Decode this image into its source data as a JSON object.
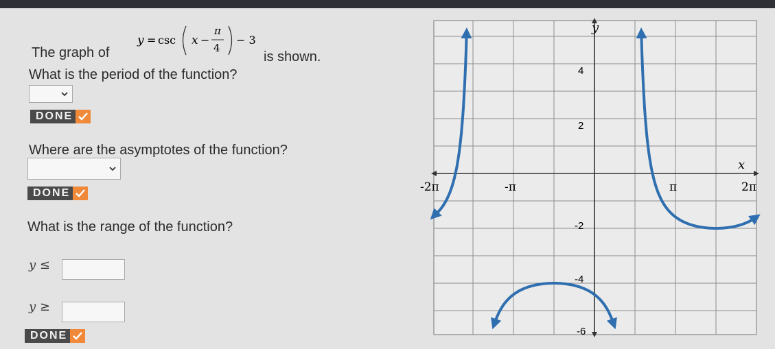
{
  "question": {
    "intro": "The graph of",
    "formula": {
      "lhs": "y",
      "eq": "=",
      "func": "csc",
      "var": "x",
      "minus": "−",
      "pi": "π",
      "den": "4",
      "shift": "− 3"
    },
    "shown": "is shown."
  },
  "period": {
    "question": "What is the period of the function?",
    "selected": ""
  },
  "asymptotes": {
    "question": "Where are the asymptotes of the function?",
    "selected": ""
  },
  "range": {
    "question": "What is the range of the function?",
    "le_label": "y ≤",
    "ge_label": "y ≥",
    "le_value": "",
    "ge_value": ""
  },
  "done_label": "DONE",
  "colors": {
    "curve": "#2f6fb0",
    "done_bg": "#4a4a4a",
    "check": "#f08a3a"
  },
  "graph": {
    "x_axis_label": "x",
    "y_axis_label": "y",
    "x_ticks": [
      "-2π",
      "-π",
      "π",
      "2π"
    ],
    "y_ticks": [
      "4",
      "2",
      "-2",
      "-4",
      "-6"
    ]
  }
}
